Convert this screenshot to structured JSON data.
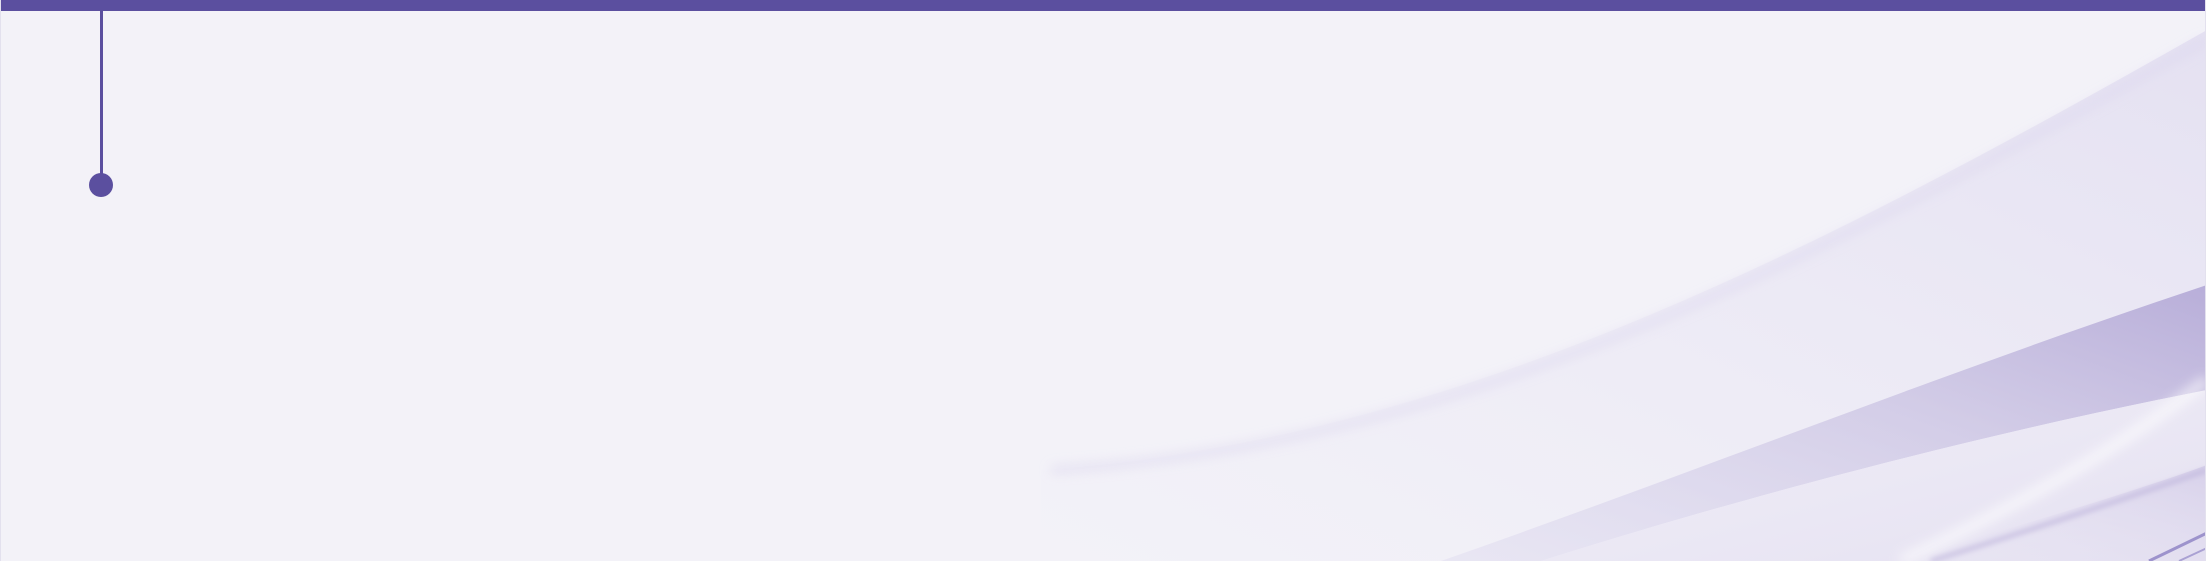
{
  "theme": {
    "background": "#f3f2f8",
    "accent": "#5b4f9f",
    "wave_light": "#e6e2f2",
    "wave_mid": "#c9c2e2",
    "wave_dark": "#9d93cc"
  }
}
